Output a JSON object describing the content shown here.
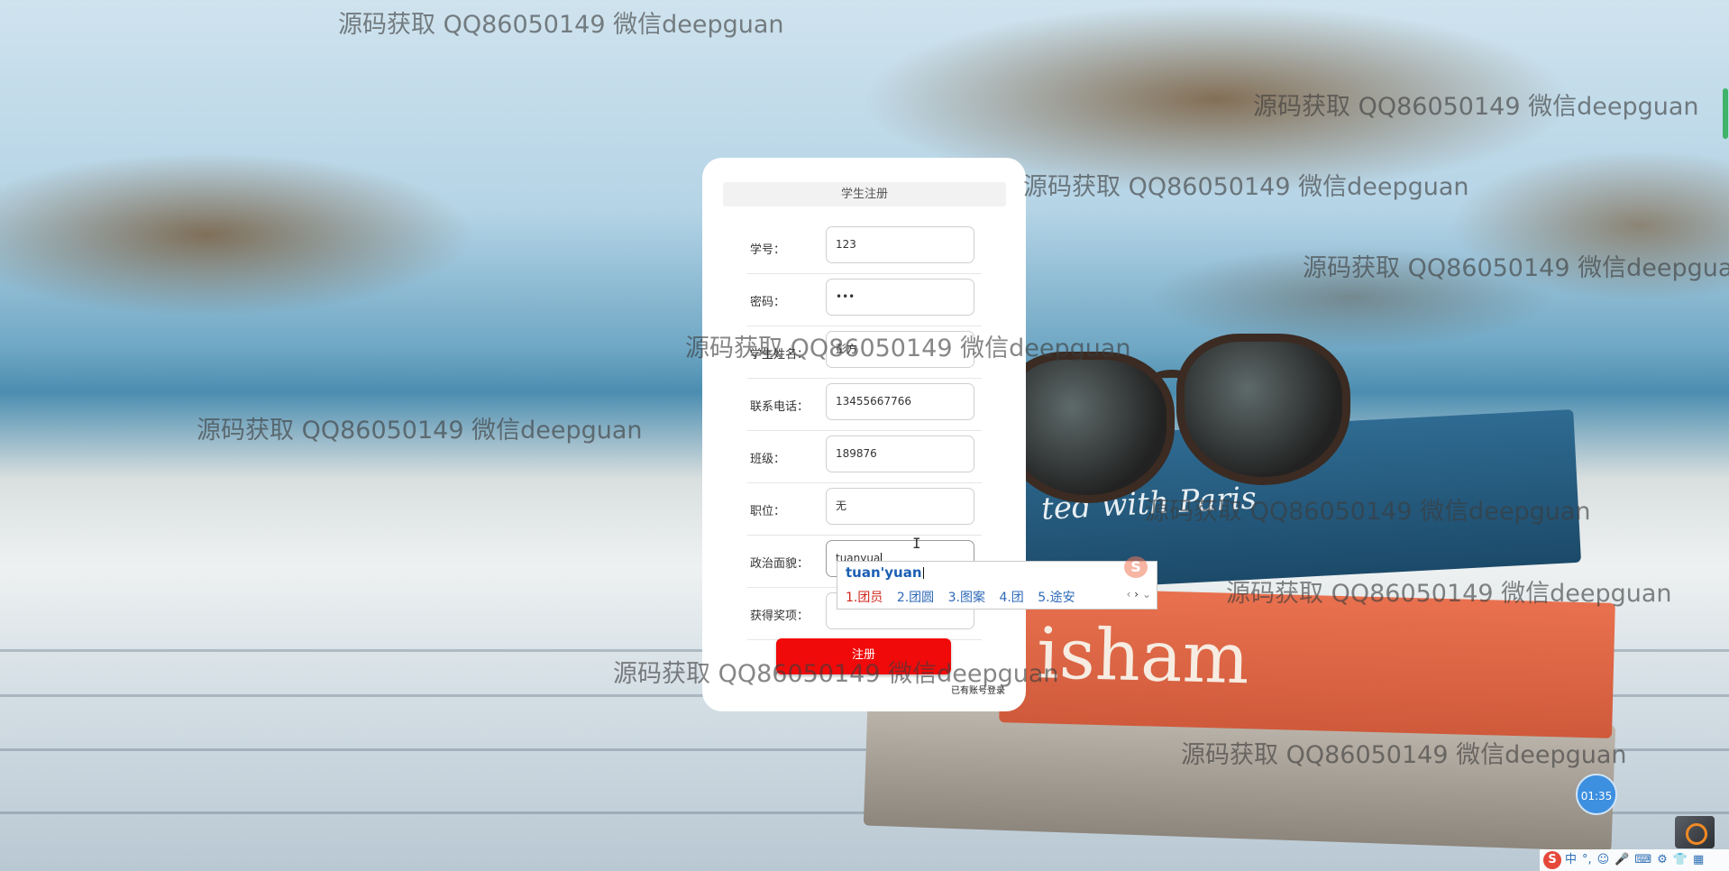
{
  "form": {
    "title": "学生注册",
    "fields": [
      {
        "label": "学号：",
        "value": "123"
      },
      {
        "label": "密码：",
        "value": "•••"
      },
      {
        "label": "学生姓名：",
        "value": "彭方"
      },
      {
        "label": "联系电话：",
        "value": "13455667766"
      },
      {
        "label": "班级：",
        "value": "189876"
      },
      {
        "label": "职位：",
        "value": "无"
      },
      {
        "label": "政治面貌：",
        "value": "tuanyua"
      },
      {
        "label": "获得奖项：",
        "value": ""
      }
    ],
    "register_button": "注册",
    "login_link": "已有账号登录"
  },
  "ime": {
    "composition": "tuan'yuan",
    "candidates": [
      "1.团员",
      "2.团圆",
      "3.图案",
      "4.团",
      "5.途安"
    ],
    "logo": "S"
  },
  "watermark_text": "源码获取 QQ86050149 微信deepguan",
  "background_book_text": {
    "blue_book": "ted with Paris",
    "red_book": "isham"
  },
  "timer": "01:35",
  "taskbar": {
    "ime_logo": "S",
    "ime_lang": "中"
  },
  "colors": {
    "register_button": "#f10a0a",
    "candidate_first": "#d0261c",
    "candidate_other": "#2e69b8"
  }
}
